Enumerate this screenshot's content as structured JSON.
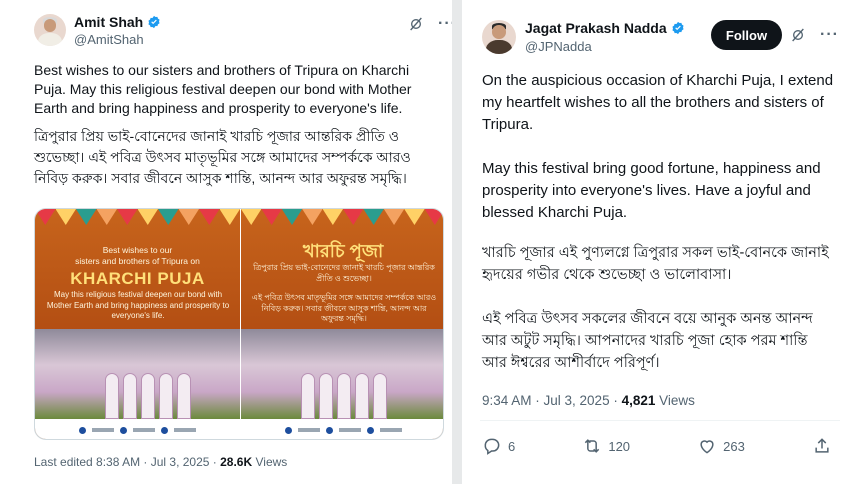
{
  "left_post": {
    "author_name": "Amit Shah",
    "handle": "@AmitShah",
    "text_en": "Best wishes to our sisters and brothers of Tripura on Kharchi Puja. May this religious festival deepen our bond with Mother Earth and bring happiness and prosperity to everyone's life.",
    "text_bn": "ত্রিপুরার প্রিয় ভাই-বোনেদের জানাই খারচি পূজার আন্তরিক প্রীতি ও শুভেচ্ছা। এই পবিত্র উৎসব মাতৃভূমির সঙ্গে আমাদের সম্পর্ককে আরও নিবিড় করুক। সবার জীবনে আসুক শান্তি, আনন্দ আর অফুরন্ত সমৃদ্ধি।",
    "poster_left": {
      "greeting_line1": "Best wishes to our",
      "greeting_line2": "sisters and brothers of Tripura on",
      "title": "KHARCHI PUJA",
      "body": "May this religious festival deepen our bond with Mother Earth and bring happiness and prosperity to everyone's life."
    },
    "poster_right": {
      "title": "খারচি পূজা",
      "body1": "ত্রিপুরার প্রিয় ভাই-বোনেদের জানাই খারচি পূজার আন্তরিক প্রীতি ও শুভেচ্ছা।",
      "body2": "এই পবিত্র উৎসব মাতৃভূমির সঙ্গে আমাদের সম্পর্ককে আরও নিবিড় করুক। সবার জীবনে আসুক শান্তি, আনন্দ আর অফুরন্ত সমৃদ্ধি।"
    },
    "meta_prefix": "Last edited 8:38 AM · Jul 3, 2025 · ",
    "views_count": "28.6K",
    "views_label": " Views"
  },
  "right_post": {
    "author_name": "Jagat Prakash Nadda",
    "handle": "@JPNadda",
    "follow_label": "Follow",
    "para1": "On the auspicious occasion of Kharchi Puja, I extend my heartfelt wishes to all the brothers and sisters of Tripura.",
    "para2": "May this festival bring good fortune, happiness and prosperity into everyone's lives. Have a joyful and blessed Kharchi Puja.",
    "para3": "খারচি পূজার এই পুণ্যলগ্নে ত্রিপুরার সকল ভাই-বোনকে জানাই হৃদয়ের গভীর থেকে শুভেচ্ছা ও ভালোবাসা।",
    "para4": "এই পবিত্র উৎসব সকলের জীবনে বয়ে আনুক অনন্ত আনন্দ আর অটুট সমৃদ্ধি। আপনাদের খারচি পূজা হোক পরম শান্তি আর ঈশ্বরের আশীর্বাদে পরিপূর্ণ।",
    "meta_prefix": "9:34 AM · Jul 3, 2025 · ",
    "views_count": "4,821",
    "views_label": " Views",
    "replies": "6",
    "reposts": "120",
    "likes": "263"
  },
  "colors": {
    "accent_verified": "#1d9bf0",
    "text_primary": "#0f1419",
    "text_secondary": "#536471",
    "poster_orange": "#c7641c"
  },
  "icons": [
    "verified-badge-icon",
    "grok-icon",
    "more-icon",
    "reply-icon",
    "repost-icon",
    "like-icon",
    "share-icon"
  ]
}
